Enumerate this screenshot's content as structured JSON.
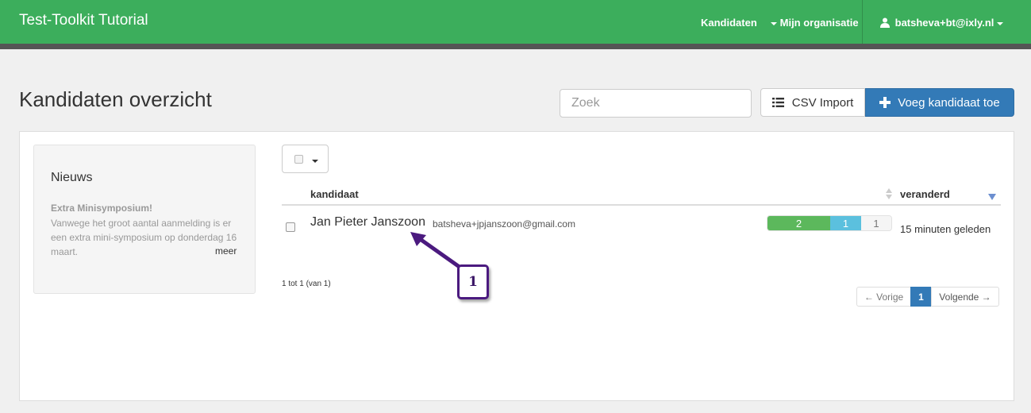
{
  "navbar": {
    "brand": "Test-Toolkit Tutorial",
    "links": {
      "kandidaten": "Kandidaten",
      "organisatie": "Mijn organisatie",
      "user": "batsheva+bt@ixly.nl"
    }
  },
  "header": {
    "title": "Kandidaten overzicht",
    "search_placeholder": "Zoek",
    "csv_import_label": "CSV Import",
    "add_candidate_label": "Voeg kandidaat toe"
  },
  "news": {
    "title": "Nieuws",
    "item_title": "Extra Minisymposium!",
    "item_body": "Vanwege het groot aantal aanmelding is er een extra mini-symposium op donderdag 16 maart.",
    "more_label": "meer"
  },
  "table": {
    "columns": {
      "candidate": "kandidaat",
      "changed": "veranderd"
    },
    "rows": [
      {
        "name": "Jan Pieter Janszoon",
        "email": "batsheva+jpjanszoon@gmail.com",
        "progress": {
          "completed": "2",
          "in_progress": "1",
          "pending": "1"
        },
        "changed": "15 minuten geleden"
      }
    ],
    "count_text": "1 tot 1 (van 1)"
  },
  "pagination": {
    "prev": "← Vorige",
    "current": "1",
    "next": "Volgende →"
  },
  "annotation": {
    "label": "1",
    "color": "#4b1a7f"
  },
  "colors": {
    "navbar": "#3cae5c",
    "primary": "#337ab7",
    "progress_green": "#5cb85c",
    "progress_blue": "#5bc0de"
  }
}
